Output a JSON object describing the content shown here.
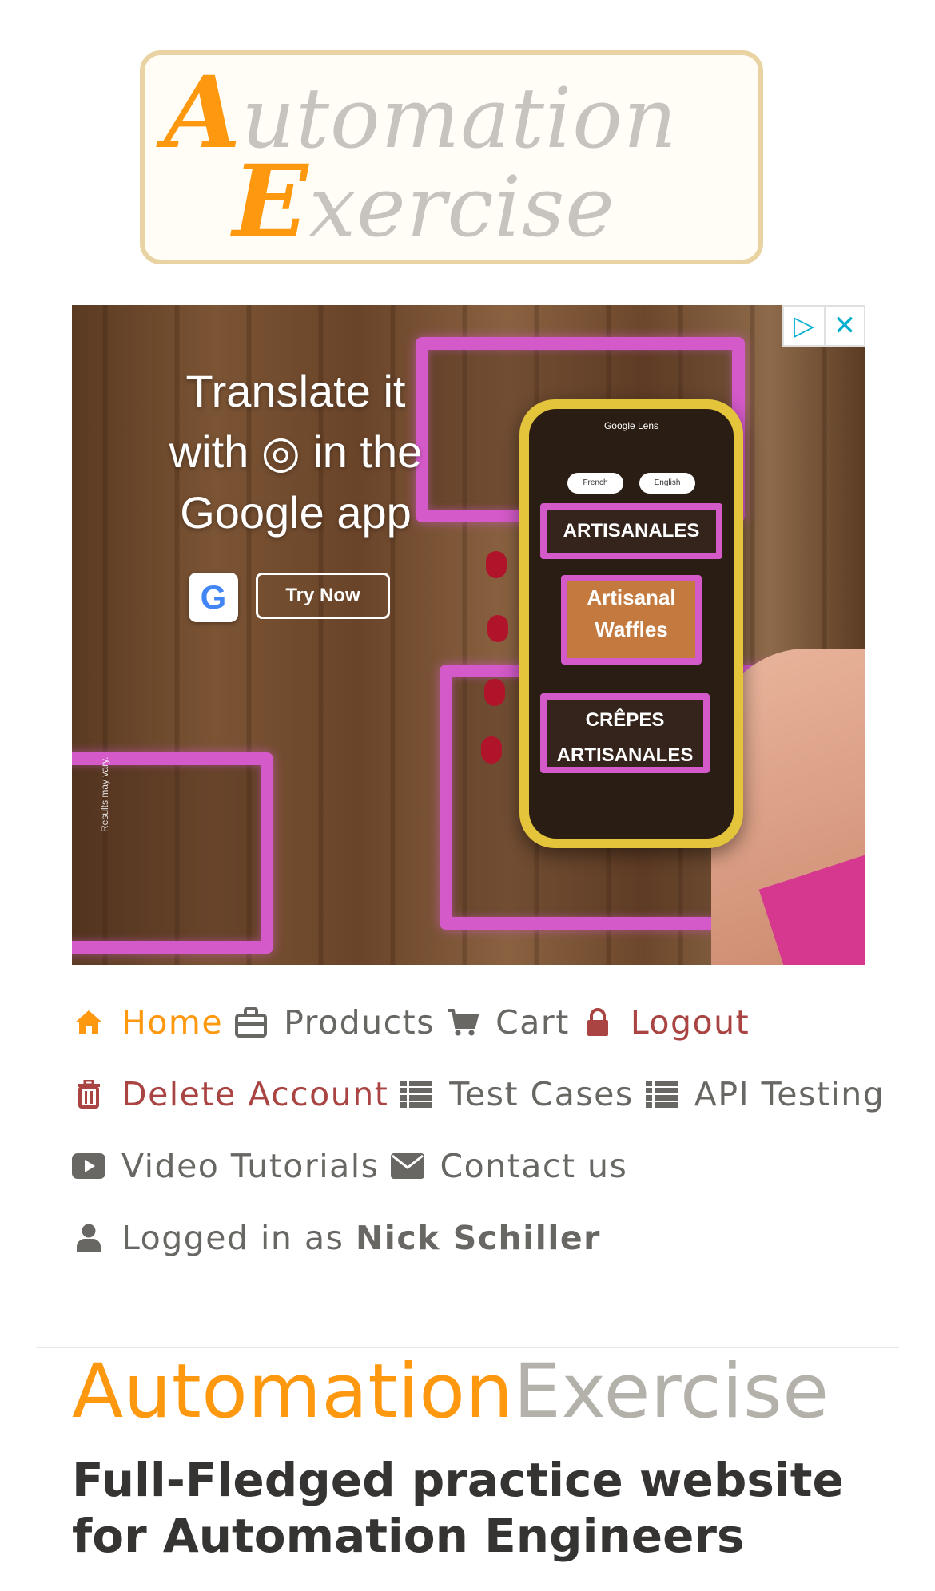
{
  "logo": {
    "line1_cap": "A",
    "line1_rest": "utomation",
    "line2_cap": "E",
    "line2_rest": "xercise",
    "colors": {
      "accent": "#fe980f",
      "muted": "#c7c4c0",
      "border": "#e9d3a2"
    }
  },
  "ad": {
    "headline_lines": [
      "Translate it",
      "with ◎ in the",
      "Google app"
    ],
    "cta": "Try Now",
    "g_badge": "G",
    "disclaimer": "Results may vary.",
    "phone": {
      "lens_label": "Google Lens",
      "lang_from": "French",
      "lang_to": "English",
      "sign_top": "ARTISANALES",
      "sign_mid_1": "Artisanal",
      "sign_mid_2": "Waffles",
      "sign_bottom_1": "CRÊPES",
      "sign_bottom_2": "ARTISANALES"
    },
    "choice_icons": [
      "adchoices-icon",
      "close-icon"
    ]
  },
  "nav": {
    "home": "Home",
    "products": "Products",
    "cart": "Cart",
    "logout": "Logout",
    "delete_account": "Delete Account",
    "test_cases": "Test Cases",
    "api_testing": "API Testing",
    "video_tutorials": "Video Tutorials",
    "contact_us": "Contact us",
    "logged_in_prefix": "Logged in as",
    "logged_in_user": "Nick Schiller",
    "colors": {
      "active": "#fe980f",
      "danger": "#a94442",
      "default": "#696763"
    }
  },
  "hero": {
    "brand_part_1": "Automation",
    "brand_part_2": "Exercise",
    "headline": "Full-Fledged practice website for Automation Engineers"
  }
}
